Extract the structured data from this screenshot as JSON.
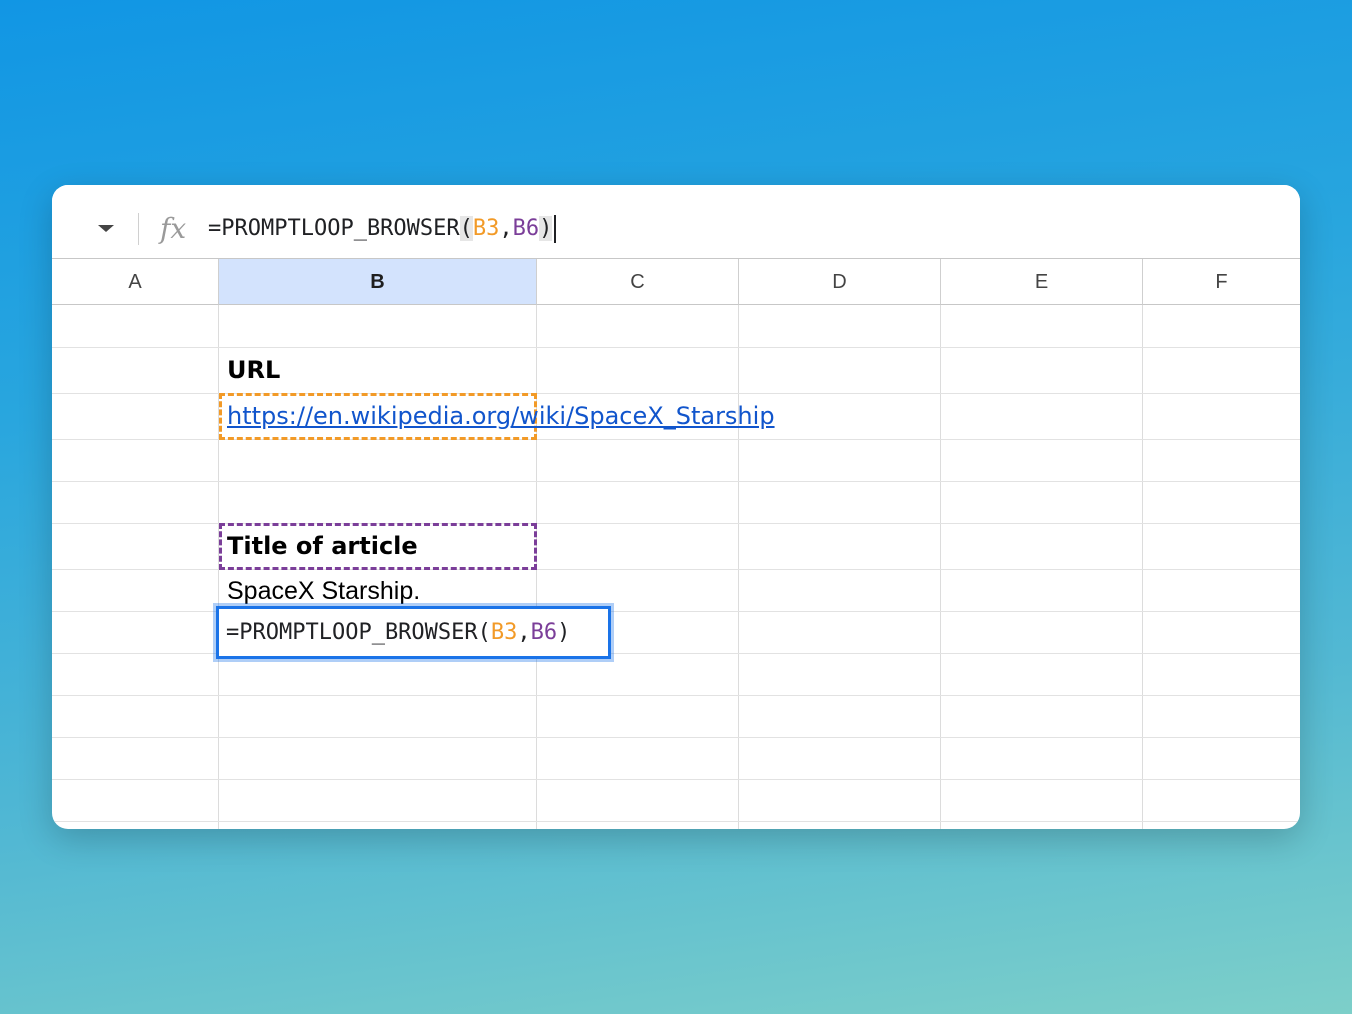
{
  "formula_bar": {
    "fx_label": "fx",
    "formula": {
      "prefix": "=PROMPTLOOP_BROWSER",
      "open_paren": "(",
      "ref1": "B3",
      "comma": ",",
      "ref2": "B6",
      "close_paren": ")"
    }
  },
  "columns": [
    "A",
    "B",
    "C",
    "D",
    "E",
    "F"
  ],
  "active_column": "B",
  "cells": {
    "B2": "URL",
    "B3": "https://en.wikipedia.org/wiki/SpaceX_Starship",
    "B6": "Title of article",
    "B7": "SpaceX Starship.",
    "B8": {
      "prefix": "=PROMPTLOOP_BROWSER",
      "open_paren": "(",
      "ref1": "B3",
      "comma": ",",
      "ref2": "B6",
      "close_paren": ")"
    }
  },
  "colors": {
    "ref1": "#f29a27",
    "ref2": "#7b3e99",
    "link": "#1155cc",
    "selection": "#1a73e8",
    "active_header": "#d3e3fd"
  }
}
